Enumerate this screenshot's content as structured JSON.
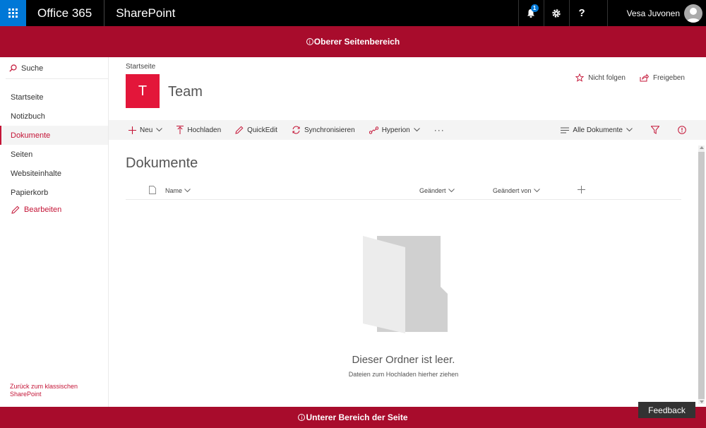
{
  "suitebar": {
    "app_launcher_icon": "waffle-icon",
    "office_label": "Office 365",
    "sharepoint_label": "SharePoint",
    "notification_count": "1",
    "help_glyph": "?",
    "user_name": "Vesa Juvonen"
  },
  "top_band": {
    "label": "Oberer Seitenbereich",
    "color": "#a80c2c"
  },
  "bottom_band": {
    "label": "Unterer Bereich der Seite",
    "color": "#a80c2c"
  },
  "nav": {
    "search_label": "Suche",
    "items": [
      {
        "label": "Startseite"
      },
      {
        "label": "Notizbuch"
      },
      {
        "label": "Dokumente",
        "selected": true
      },
      {
        "label": "Seiten"
      },
      {
        "label": "Websiteinhalte"
      },
      {
        "label": "Papierkorb"
      }
    ],
    "edit_label": "Bearbeiten",
    "back_label": "Zurück zum klassischen SharePoint"
  },
  "header": {
    "breadcrumb": "Startseite",
    "logo_letter": "T",
    "site_title": "Team",
    "follow_label": "Nicht folgen",
    "share_label": "Freigeben",
    "accent": "#e3163a"
  },
  "commandbar": {
    "new_label": "Neu",
    "upload_label": "Hochladen",
    "quickedit_label": "QuickEdit",
    "sync_label": "Synchronisieren",
    "hyperion_label": "Hyperion",
    "more_label": "···",
    "view_label": "Alle Dokumente"
  },
  "library": {
    "title": "Dokumente",
    "columns": {
      "name": "Name",
      "modified": "Geändert",
      "modified_by": "Geändert von"
    },
    "empty_title": "Dieser Ordner ist leer.",
    "empty_subtitle": "Dateien zum Hochladen hierher ziehen"
  },
  "feedback_label": "Feedback"
}
